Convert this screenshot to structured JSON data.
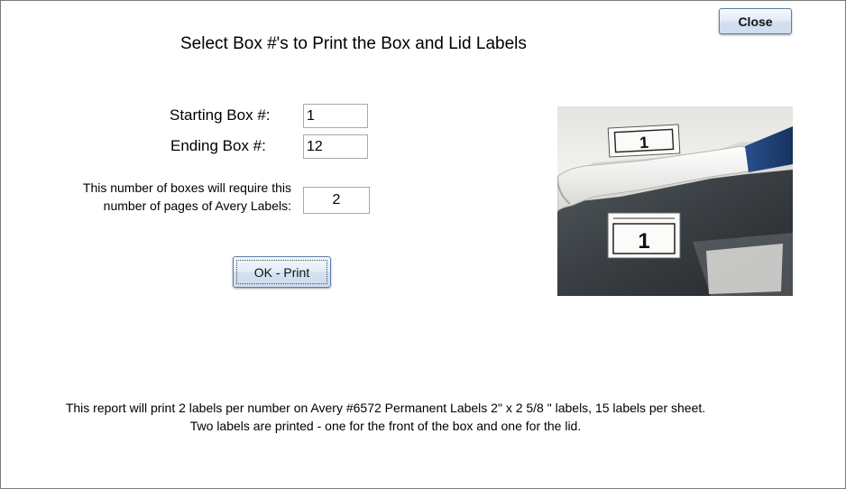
{
  "window": {
    "close_label": "Close"
  },
  "main": {
    "title": "Select Box #'s to Print the Box and Lid Labels",
    "starting_label": "Starting Box #:",
    "starting_value": "1",
    "ending_label": "Ending Box #:",
    "ending_value": "12",
    "pages_label_line1": "This number of boxes will require this",
    "pages_label_line2": "number of pages of Avery Labels:",
    "pages_value": "2",
    "print_button": "OK - Print"
  },
  "photo": {
    "lid_label_number": "1",
    "box_label_number": "1"
  },
  "footer": {
    "line1": "This report will print 2 labels per number on Avery #6572 Permanent Labels  2\" x 2 5/8 \" labels,  15 labels per sheet.",
    "line2": "Two labels are printed - one for the front of the box and one for the lid."
  },
  "colors": {
    "button_border": "#5c7fa8",
    "button_fill": "#dde7f4",
    "lid_accent_blue": "#1e3f7a"
  }
}
